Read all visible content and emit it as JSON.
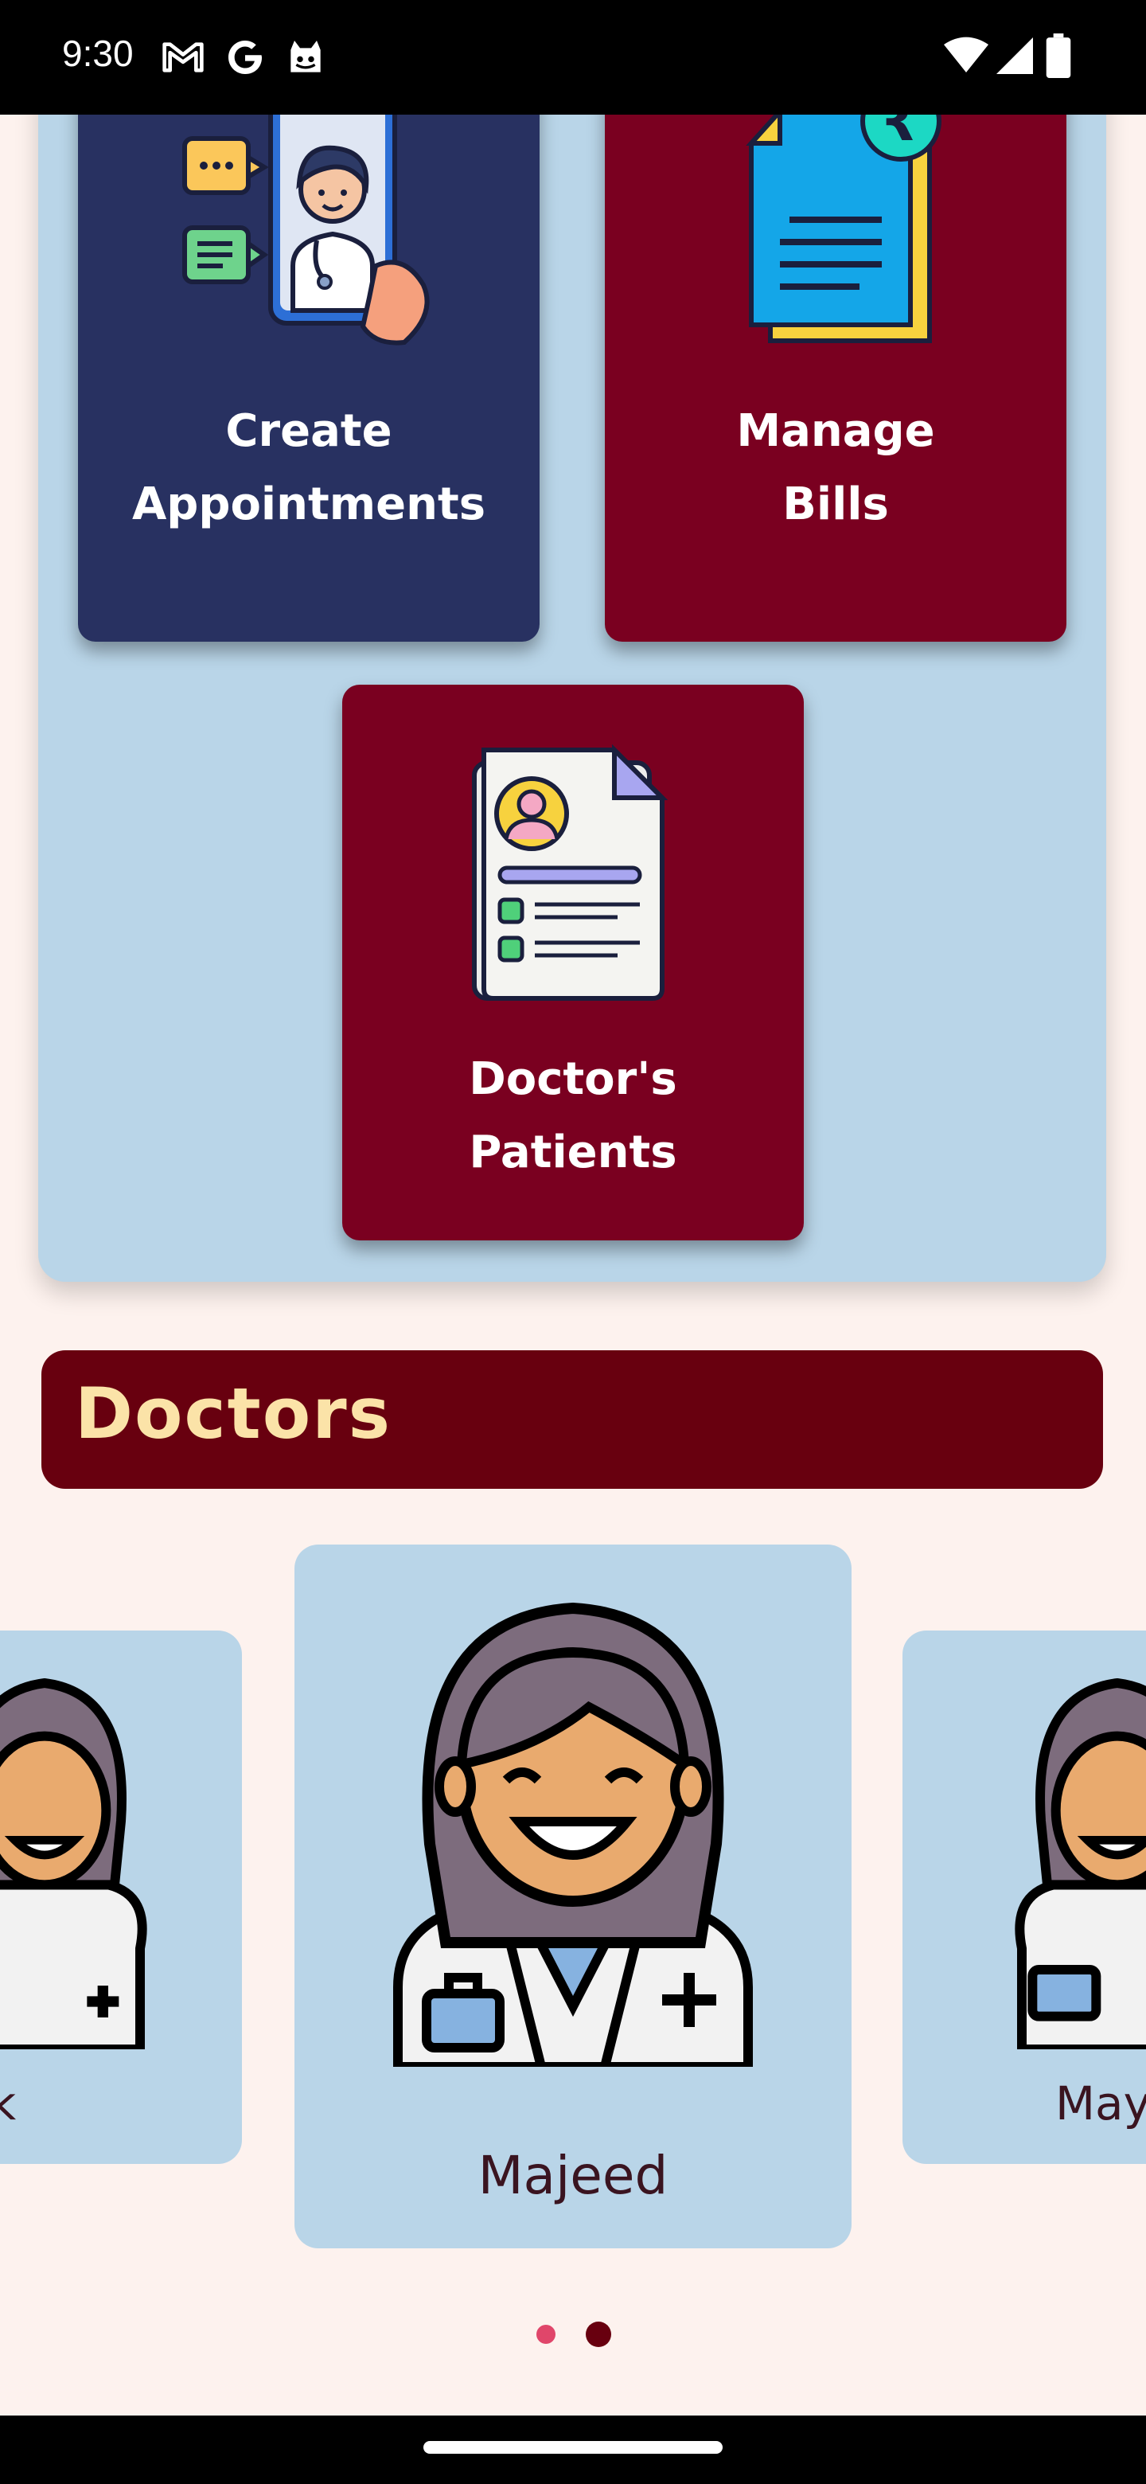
{
  "status_bar": {
    "time": "9:30",
    "icons": [
      "gmail-icon",
      "google-icon",
      "cat-icon",
      "wifi-icon",
      "signal-icon",
      "battery-icon"
    ]
  },
  "dashboard": {
    "tiles": [
      {
        "label": "Create\nAppointments",
        "icon": "doctor-phone-icon",
        "color": "#283161"
      },
      {
        "label": "Manage\nBills",
        "icon": "rupee-bill-icon",
        "color": "#7a0020"
      },
      {
        "label": "Doctor's\nPatients",
        "icon": "patient-record-icon",
        "color": "#7a0020"
      }
    ],
    "panel_color": "#b9d5e8"
  },
  "doctors_section": {
    "title": "Doctors",
    "header_color": "#68000f",
    "title_color": "#fbe3a8",
    "cards": [
      {
        "name": "yank",
        "position": "previous"
      },
      {
        "name": "Majeed",
        "position": "current"
      },
      {
        "name": "May",
        "position": "next"
      }
    ],
    "pager": {
      "count": 2,
      "active_index": 1,
      "active_color": "#68000f",
      "inactive_color": "#e0466a"
    }
  }
}
